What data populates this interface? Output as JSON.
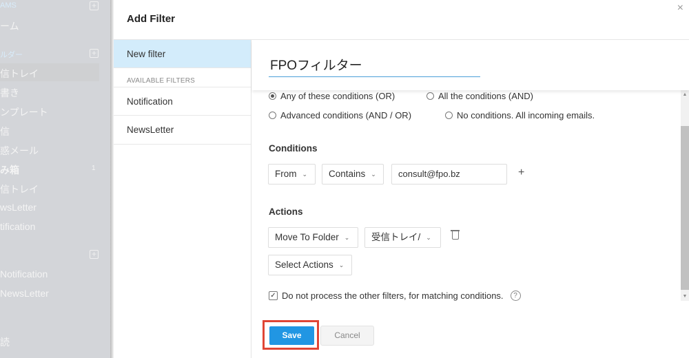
{
  "sidebar": {
    "items": [
      {
        "label": "AMS",
        "type": "header"
      },
      {
        "label": "ーム"
      },
      {
        "label": "ルダー",
        "type": "header"
      },
      {
        "label": "信トレイ"
      },
      {
        "label": "書き"
      },
      {
        "label": "ンプレート"
      },
      {
        "label": "信"
      },
      {
        "label": "惑メール"
      },
      {
        "label": "み箱",
        "count": "1"
      },
      {
        "label": "信トレイ"
      },
      {
        "label": "wsLetter"
      },
      {
        "label": "tification"
      },
      {
        "label": "Notification"
      },
      {
        "label": "NewsLetter"
      },
      {
        "label": "読"
      }
    ]
  },
  "dialog": {
    "title": "Add Filter",
    "close": "×",
    "filters": {
      "new": "New filter",
      "available_label": "AVAILABLE FILTERS",
      "items": [
        "Notification",
        "NewsLetter"
      ]
    },
    "name": "FPOフィルター",
    "match": {
      "options": [
        "Any of these conditions (OR)",
        "All the conditions (AND)",
        "Advanced conditions (AND / OR)",
        "No conditions. All incoming emails."
      ],
      "selected": 0
    },
    "conditions": {
      "label": "Conditions",
      "field": "From",
      "operator": "Contains",
      "value": "consult@fpo.bz",
      "add": "+"
    },
    "actions": {
      "label": "Actions",
      "action": "Move To Folder",
      "folder": "受信トレイ/",
      "select": "Select Actions"
    },
    "stop_processing": {
      "label": "Do not process the other filters, for matching conditions.",
      "checked": true
    },
    "save": "Save",
    "cancel": "Cancel"
  },
  "colors": {
    "accent": "#2196e3",
    "highlight": "#e04535",
    "selected_filter": "#d3ecfb"
  }
}
